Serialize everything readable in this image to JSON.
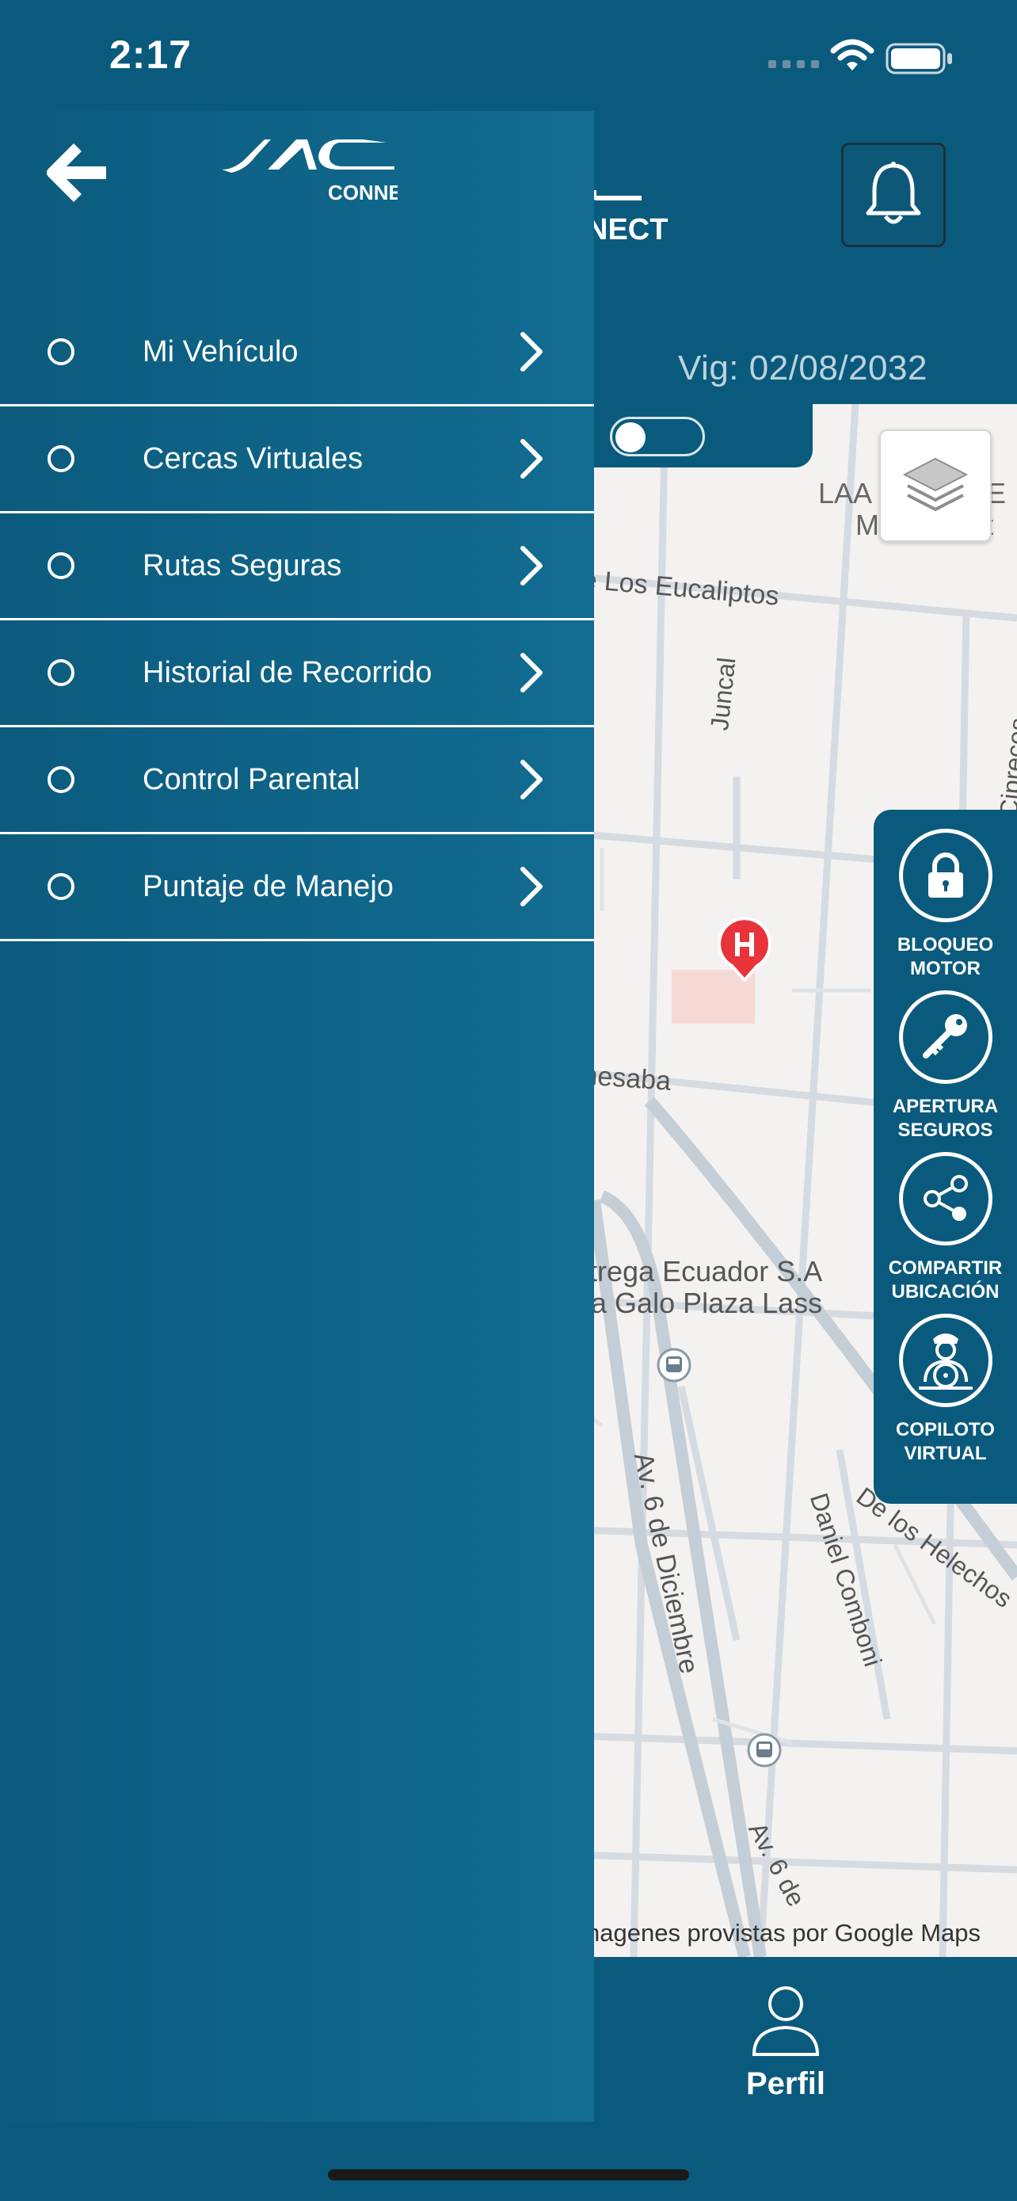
{
  "status_bar": {
    "time": "2:17"
  },
  "header": {
    "brand_subtext_partial": "NECT",
    "vig_text": "Vig: 02/08/2032"
  },
  "map": {
    "attribution": "nagenes provistas por Google Maps",
    "street_labels": [
      "LAA",
      "IE",
      "Matriz Quit",
      "De Los Eucaliptos",
      "Juncal",
      "Cipreces",
      "Amesaba",
      "entrega Ecuador S.A",
      "ncia Galo Plaza Lass",
      "Av. 6 de Diciembre",
      "Daniel Comboni",
      "De los Helechos",
      "Av. 6 de",
      "a"
    ]
  },
  "actions": [
    {
      "icon": "lock-icon",
      "label_line1": "BLOQUEO",
      "label_line2": "MOTOR"
    },
    {
      "icon": "key-icon",
      "label_line1": "APERTURA",
      "label_line2": "SEGUROS"
    },
    {
      "icon": "share-icon",
      "label_line1": "COMPARTIR",
      "label_line2": "UBICACIÓN"
    },
    {
      "icon": "copilot-icon",
      "label_line1": "COPILOTO",
      "label_line2": "VIRTUAL"
    }
  ],
  "bottom_nav": {
    "profile_label": "Perfil"
  },
  "drawer": {
    "logo_subtext": "CONNECT",
    "menu_items": [
      {
        "label": "Mi Vehículo"
      },
      {
        "label": "Cercas Virtuales"
      },
      {
        "label": "Rutas Seguras"
      },
      {
        "label": "Historial de Recorrido"
      },
      {
        "label": "Control Parental"
      },
      {
        "label": "Puntaje de Manejo"
      }
    ]
  },
  "colors": {
    "primary": "#0a5a7d",
    "drawer_gradient_end": "#126c91",
    "map_background": "#f4f2f0",
    "marker_red": "#e8333a"
  }
}
